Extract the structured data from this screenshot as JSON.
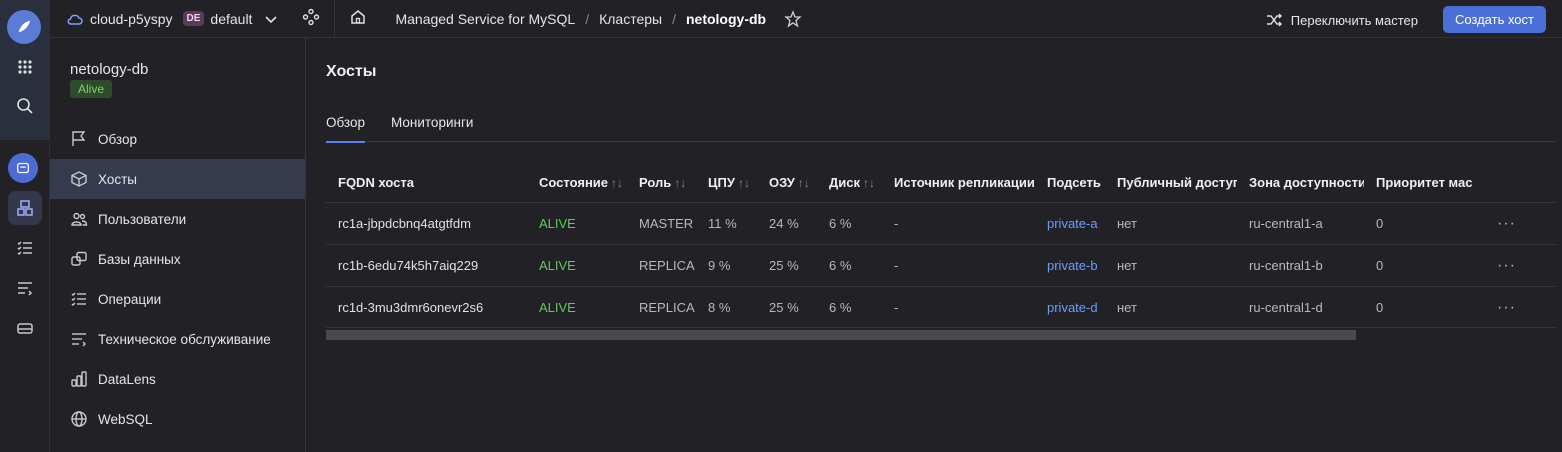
{
  "topbar": {
    "cloud_name": "cloud-p5yspy",
    "folder_badge": "DE",
    "folder_name": "default",
    "breadcrumbs": [
      "Managed Service for MySQL",
      "Кластеры",
      "netology-db"
    ],
    "switch_label": "Переключить мастер",
    "create_label": "Создать хост"
  },
  "sidebar": {
    "cluster_name": "netology-db",
    "status": "Alive",
    "items": [
      {
        "label": "Обзор",
        "icon": "flag-icon"
      },
      {
        "label": "Хосты",
        "icon": "cube-icon"
      },
      {
        "label": "Пользователи",
        "icon": "users-icon"
      },
      {
        "label": "Базы данных",
        "icon": "databases-icon"
      },
      {
        "label": "Операции",
        "icon": "operations-icon"
      },
      {
        "label": "Техническое обслуживание",
        "icon": "maintenance-icon"
      },
      {
        "label": "DataLens",
        "icon": "datalens-icon"
      },
      {
        "label": "WebSQL",
        "icon": "globe-icon"
      }
    ]
  },
  "main": {
    "title": "Хосты",
    "tabs": [
      "Обзор",
      "Мониторинги"
    ],
    "columns": [
      "FQDN хоста",
      "Состояние",
      "Роль",
      "ЦПУ",
      "ОЗУ",
      "Диск",
      "Источник репликации",
      "Подсеть",
      "Публичный доступ",
      "Зона доступности",
      "Приоритет мас"
    ],
    "sort_glyph": "↑↓",
    "rows": [
      {
        "fqdn": "rc1a-jbpdcbnq4atgtfdm",
        "state": "ALIVE",
        "role": "MASTER",
        "cpu": "11 %",
        "ram": "24 %",
        "disk": "6 %",
        "source": "-",
        "subnet": "private-a",
        "public": "нет",
        "zone": "ru-central1-a",
        "priority": "0"
      },
      {
        "fqdn": "rc1b-6edu74k5h7aiq229",
        "state": "ALIVE",
        "role": "REPLICA",
        "cpu": "9 %",
        "ram": "25 %",
        "disk": "6 %",
        "source": "-",
        "subnet": "private-b",
        "public": "нет",
        "zone": "ru-central1-b",
        "priority": "0"
      },
      {
        "fqdn": "rc1d-3mu3dmr6onevr2s6",
        "state": "ALIVE",
        "role": "REPLICA",
        "cpu": "8 %",
        "ram": "25 %",
        "disk": "6 %",
        "source": "-",
        "subnet": "private-d",
        "public": "нет",
        "zone": "ru-central1-d",
        "priority": "0"
      }
    ],
    "row_menu": "···"
  },
  "colors": {
    "accent": "#4a6fd6",
    "alive": "#5fc95a",
    "link": "#6a9cff"
  }
}
